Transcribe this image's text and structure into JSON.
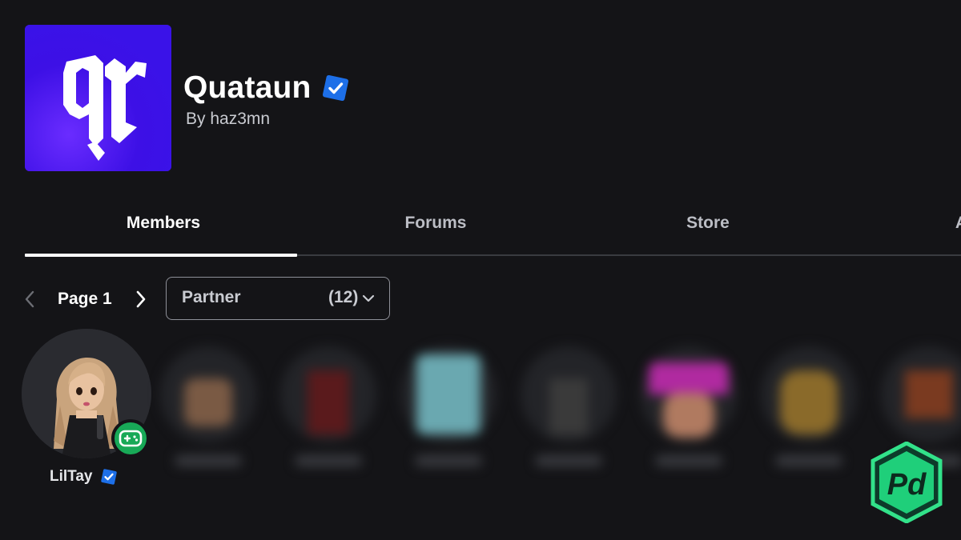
{
  "group": {
    "title": "Quataun",
    "owner": "By haz3mn",
    "logo_text": "qr",
    "logo_color": "#3f12ea"
  },
  "tabs": [
    {
      "label": "Members",
      "active": true
    },
    {
      "label": "Forums",
      "active": false
    },
    {
      "label": "Store",
      "active": false
    },
    {
      "label": "Af",
      "active": false
    }
  ],
  "pager": {
    "label": "Page 1",
    "prev_icon": "chevron-left-icon",
    "next_icon": "chevron-right-icon"
  },
  "role_filter": {
    "selected": "Partner",
    "count": "(12)",
    "icon": "chevron-down-icon"
  },
  "members": [
    {
      "name": "LilTay",
      "verified": true,
      "presence": "in-game",
      "presence_icon": "gamepad-icon"
    }
  ],
  "colors": {
    "background": "#141417",
    "verified": "#1d6fe8",
    "presence": "#18a957",
    "accent": "#ffffff"
  },
  "watermark": {
    "logo_text": "Pd"
  }
}
